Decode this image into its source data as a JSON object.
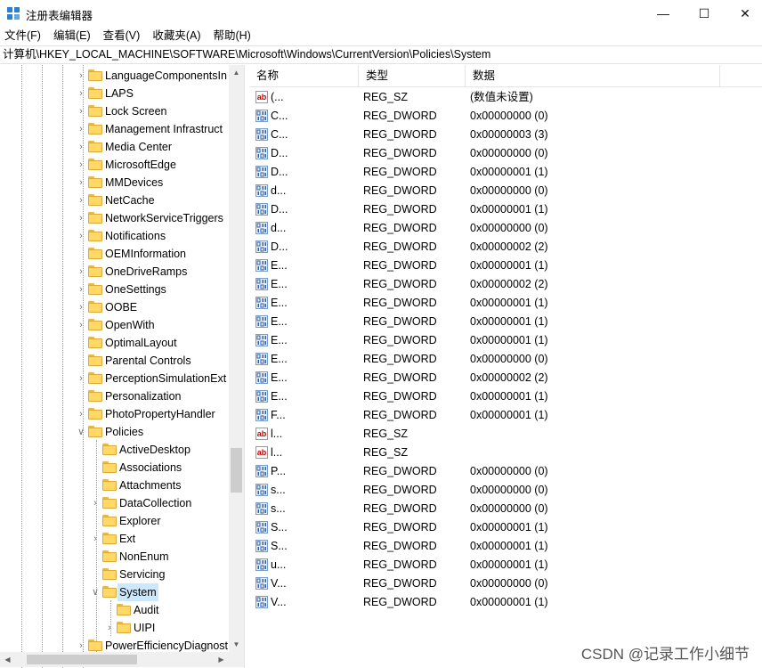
{
  "window": {
    "title": "注册表编辑器",
    "minimize_glyph": "—",
    "maximize_glyph": "☐",
    "close_glyph": "✕"
  },
  "menu": [
    "文件(F)",
    "编辑(E)",
    "查看(V)",
    "收藏夹(A)",
    "帮助(H)"
  ],
  "address": "计算机\\HKEY_LOCAL_MACHINE\\SOFTWARE\\Microsoft\\Windows\\CurrentVersion\\Policies\\System",
  "tree": [
    {
      "label": "LanguageComponentsIn",
      "depth": 0,
      "expander": "collapsed"
    },
    {
      "label": "LAPS",
      "depth": 0,
      "expander": "collapsed"
    },
    {
      "label": "Lock Screen",
      "depth": 0,
      "expander": "collapsed"
    },
    {
      "label": "Management Infrastruct",
      "depth": 0,
      "expander": "collapsed"
    },
    {
      "label": "Media Center",
      "depth": 0,
      "expander": "collapsed"
    },
    {
      "label": "MicrosoftEdge",
      "depth": 0,
      "expander": "collapsed"
    },
    {
      "label": "MMDevices",
      "depth": 0,
      "expander": "collapsed"
    },
    {
      "label": "NetCache",
      "depth": 0,
      "expander": "collapsed"
    },
    {
      "label": "NetworkServiceTriggers",
      "depth": 0,
      "expander": "collapsed"
    },
    {
      "label": "Notifications",
      "depth": 0,
      "expander": "collapsed"
    },
    {
      "label": "OEMInformation",
      "depth": 0,
      "expander": "none"
    },
    {
      "label": "OneDriveRamps",
      "depth": 0,
      "expander": "collapsed"
    },
    {
      "label": "OneSettings",
      "depth": 0,
      "expander": "collapsed"
    },
    {
      "label": "OOBE",
      "depth": 0,
      "expander": "collapsed"
    },
    {
      "label": "OpenWith",
      "depth": 0,
      "expander": "collapsed"
    },
    {
      "label": "OptimalLayout",
      "depth": 0,
      "expander": "none"
    },
    {
      "label": "Parental Controls",
      "depth": 0,
      "expander": "none"
    },
    {
      "label": "PerceptionSimulationExt",
      "depth": 0,
      "expander": "collapsed"
    },
    {
      "label": "Personalization",
      "depth": 0,
      "expander": "none"
    },
    {
      "label": "PhotoPropertyHandler",
      "depth": 0,
      "expander": "collapsed"
    },
    {
      "label": "Policies",
      "depth": 0,
      "expander": "expanded"
    },
    {
      "label": "ActiveDesktop",
      "depth": 1,
      "expander": "none"
    },
    {
      "label": "Associations",
      "depth": 1,
      "expander": "none"
    },
    {
      "label": "Attachments",
      "depth": 1,
      "expander": "none"
    },
    {
      "label": "DataCollection",
      "depth": 1,
      "expander": "collapsed"
    },
    {
      "label": "Explorer",
      "depth": 1,
      "expander": "none"
    },
    {
      "label": "Ext",
      "depth": 1,
      "expander": "collapsed"
    },
    {
      "label": "NonEnum",
      "depth": 1,
      "expander": "none"
    },
    {
      "label": "Servicing",
      "depth": 1,
      "expander": "none"
    },
    {
      "label": "System",
      "depth": 1,
      "expander": "expanded",
      "selected": true
    },
    {
      "label": "Audit",
      "depth": 2,
      "expander": "none"
    },
    {
      "label": "UIPI",
      "depth": 2,
      "expander": "collapsed"
    },
    {
      "label": "PowerEfficiencyDiagnost",
      "depth": 0,
      "expander": "collapsed"
    }
  ],
  "list": {
    "columns": [
      "名称",
      "类型",
      "数据"
    ],
    "rows": [
      {
        "icon": "string-value-icon",
        "name": "(默认)",
        "type": "REG_SZ",
        "data": "(数值未设置)"
      },
      {
        "icon": "binary-value-icon",
        "name": "ConsentPromptBehaviorAdmin",
        "type": "REG_DWORD",
        "data": "0x00000000 (0)"
      },
      {
        "icon": "binary-value-icon",
        "name": "ConsentPromptBehaviorUser",
        "type": "REG_DWORD",
        "data": "0x00000003 (3)"
      },
      {
        "icon": "binary-value-icon",
        "name": "DelayedDesktopSwitchTimeout",
        "type": "REG_DWORD",
        "data": "0x00000000 (0)"
      },
      {
        "icon": "binary-value-icon",
        "name": "DisableAutomaticRestartSignOn",
        "type": "REG_DWORD",
        "data": "0x00000001 (1)"
      },
      {
        "icon": "binary-value-icon",
        "name": "disablecad",
        "type": "REG_DWORD",
        "data": "0x00000000 (0)"
      },
      {
        "icon": "binary-value-icon",
        "name": "DisableStartupSound",
        "type": "REG_DWORD",
        "data": "0x00000001 (1)"
      },
      {
        "icon": "binary-value-icon",
        "name": "dontdisplaylastusername",
        "type": "REG_DWORD",
        "data": "0x00000000 (0)"
      },
      {
        "icon": "binary-value-icon",
        "name": "DSCAutomationHostEnabled",
        "type": "REG_DWORD",
        "data": "0x00000002 (2)"
      },
      {
        "icon": "binary-value-icon",
        "name": "EnableCursorSuppression",
        "type": "REG_DWORD",
        "data": "0x00000001 (1)"
      },
      {
        "icon": "binary-value-icon",
        "name": "EnableFullTrustStartupTasks",
        "type": "REG_DWORD",
        "data": "0x00000002 (2)"
      },
      {
        "icon": "binary-value-icon",
        "name": "EnableInstallerDetection",
        "type": "REG_DWORD",
        "data": "0x00000001 (1)"
      },
      {
        "icon": "binary-value-icon",
        "name": "EnableLUA",
        "type": "REG_DWORD",
        "data": "0x00000001 (1)"
      },
      {
        "icon": "binary-value-icon",
        "name": "EnableSecureUIAPaths",
        "type": "REG_DWORD",
        "data": "0x00000001 (1)"
      },
      {
        "icon": "binary-value-icon",
        "name": "EnableUIADesktopToggle",
        "type": "REG_DWORD",
        "data": "0x00000000 (0)"
      },
      {
        "icon": "binary-value-icon",
        "name": "EnableUwpStartupTasks",
        "type": "REG_DWORD",
        "data": "0x00000002 (2)"
      },
      {
        "icon": "binary-value-icon",
        "name": "EnableVirtualization",
        "type": "REG_DWORD",
        "data": "0x00000001 (1)"
      },
      {
        "icon": "binary-value-icon",
        "name": "FilterAdministratorToken",
        "type": "REG_DWORD",
        "data": "0x00000001 (1)"
      },
      {
        "icon": "string-value-icon",
        "name": "legalnoticecaption",
        "type": "REG_SZ",
        "data": ""
      },
      {
        "icon": "string-value-icon",
        "name": "legalnoticetext",
        "type": "REG_SZ",
        "data": ""
      },
      {
        "icon": "binary-value-icon",
        "name": "PromptOnSecureDesktop",
        "type": "REG_DWORD",
        "data": "0x00000000 (0)"
      },
      {
        "icon": "binary-value-icon",
        "name": "scforceoption",
        "type": "REG_DWORD",
        "data": "0x00000000 (0)"
      },
      {
        "icon": "binary-value-icon",
        "name": "shutdownwithoutlogon",
        "type": "REG_DWORD",
        "data": "0x00000000 (0)"
      },
      {
        "icon": "binary-value-icon",
        "name": "SupportFullTrustStartupTasks",
        "type": "REG_DWORD",
        "data": "0x00000001 (1)"
      },
      {
        "icon": "binary-value-icon",
        "name": "SupportUwpStartupTasks",
        "type": "REG_DWORD",
        "data": "0x00000001 (1)"
      },
      {
        "icon": "binary-value-icon",
        "name": "undockwithoutlogon",
        "type": "REG_DWORD",
        "data": "0x00000001 (1)"
      },
      {
        "icon": "binary-value-icon",
        "name": "ValidateAdminCodeSignatures",
        "type": "REG_DWORD",
        "data": "0x00000000 (0)"
      },
      {
        "icon": "binary-value-icon",
        "name": "VerboseStatus",
        "type": "REG_DWORD",
        "data": "0x00000001 (1)"
      }
    ]
  },
  "watermark": "CSDN @记录工作小细节"
}
